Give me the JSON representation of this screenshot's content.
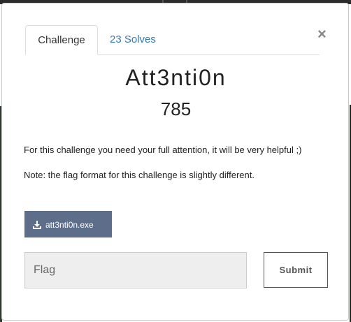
{
  "modal": {
    "tabs": [
      {
        "label": "Challenge",
        "active": true
      },
      {
        "label": "23 Solves",
        "active": false
      }
    ],
    "close_symbol": "×",
    "title": "Att3nti0n",
    "points": "785",
    "description": [
      "For this challenge you need your full attention, it will be very helpful ;)",
      "Note: the flag format for this challenge is slightly different."
    ],
    "download": {
      "icon": "download-icon",
      "label": "att3nti0n.exe"
    },
    "flag_input": {
      "placeholder": "Flag",
      "value": ""
    },
    "submit_label": "Submit"
  },
  "colors": {
    "tab_link": "#337ab7",
    "download_bg": "#5c6e8a",
    "input_bg": "#eeeeee"
  }
}
